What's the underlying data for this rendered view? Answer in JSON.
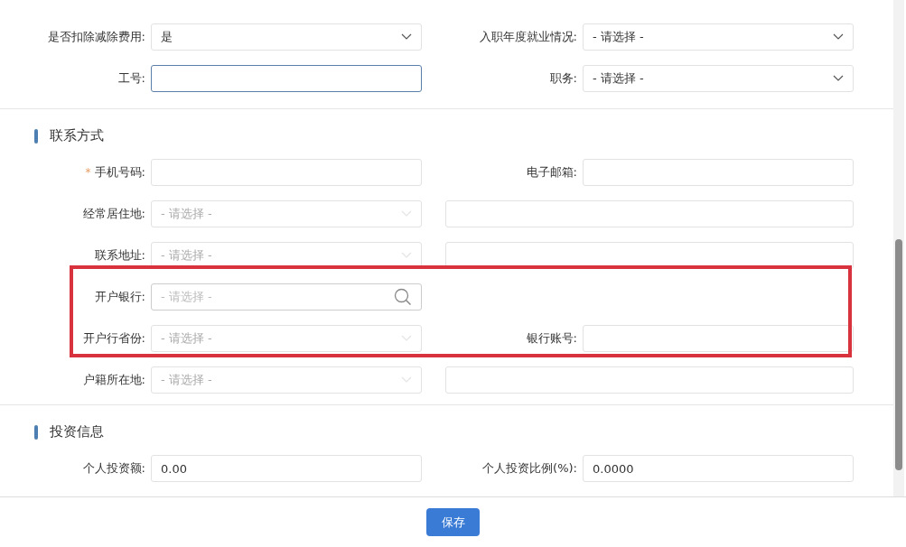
{
  "sections": [
    {
      "rows": [
        {
          "highlighted": false,
          "cells": [
            {
              "label": "是否扣除减除费用:",
              "kind": "select",
              "value": "是",
              "disabled": false
            },
            {
              "label": "入职年度就业情况:",
              "kind": "select",
              "value": "- 请选择 -",
              "disabled": false
            }
          ]
        },
        {
          "highlighted": false,
          "cells": [
            {
              "label": "工号:",
              "kind": "text",
              "focused": true
            },
            {
              "label": "职务:",
              "kind": "select",
              "value": "- 请选择 -",
              "disabled": false
            }
          ]
        }
      ]
    },
    {
      "title": "联系方式",
      "rows": [
        {
          "highlighted": false,
          "cells": [
            {
              "label": "手机号码:",
              "required_mark": "*",
              "kind": "text",
              "focused": false
            },
            {
              "label": "电子邮箱:",
              "kind": "text",
              "focused": false
            }
          ]
        },
        {
          "highlighted": false,
          "cells": [
            {
              "label": "经常居住地:",
              "kind": "select",
              "value": "- 请选择 -",
              "disabled": true
            },
            {
              "kind": "text",
              "focused": false
            }
          ]
        },
        {
          "highlighted": false,
          "cells": [
            {
              "label": "联系地址:",
              "kind": "select",
              "value": "- 请选择 -",
              "disabled": true
            },
            {
              "kind": "text",
              "focused": false
            }
          ]
        },
        {
          "highlighted": true,
          "cells": [
            {
              "label": "开户银行:",
              "kind": "search",
              "placeholder": "- 请选择 -"
            }
          ]
        },
        {
          "highlighted": true,
          "cells": [
            {
              "label": "开户行省份:",
              "kind": "select",
              "value": "- 请选择 -",
              "disabled": true
            },
            {
              "label": "银行账号:",
              "kind": "text",
              "focused": false
            }
          ]
        },
        {
          "highlighted": false,
          "cells": [
            {
              "label": "户籍所在地:",
              "kind": "select",
              "value": "- 请选择 -",
              "disabled": true
            },
            {
              "kind": "text",
              "focused": false
            }
          ]
        }
      ]
    },
    {
      "title": "投资信息",
      "rows": [
        {
          "highlighted": false,
          "cells": [
            {
              "label": "个人投资额:",
              "kind": "text",
              "value": "0.00",
              "focused": false
            },
            {
              "label": "个人投资比例(%):",
              "kind": "text",
              "value": "0.0000",
              "focused": false
            }
          ]
        }
      ]
    }
  ],
  "save_button": "保存"
}
